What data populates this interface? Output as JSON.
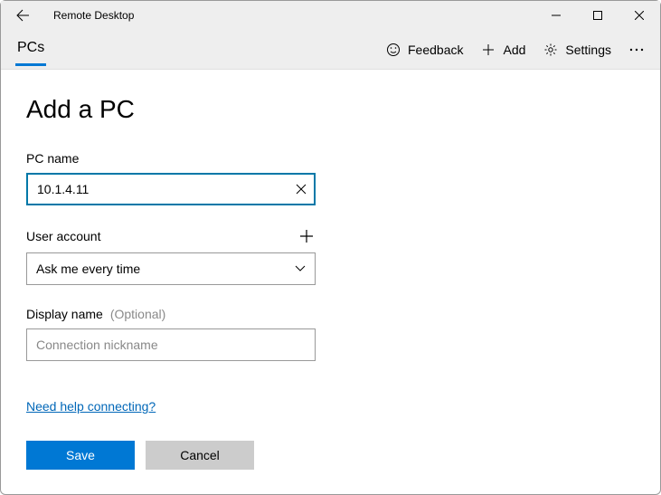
{
  "titlebar": {
    "app_name": "Remote Desktop"
  },
  "commandbar": {
    "tab_label": "PCs",
    "feedback_label": "Feedback",
    "add_label": "Add",
    "settings_label": "Settings"
  },
  "page": {
    "title": "Add a PC",
    "pc_name_label": "PC name",
    "pc_name_value": "10.1.4.11",
    "user_account_label": "User account",
    "user_account_value": "Ask me every time",
    "display_name_label": "Display name",
    "display_name_optional": "(Optional)",
    "display_name_placeholder": "Connection nickname",
    "help_link": "Need help connecting?",
    "save_label": "Save",
    "cancel_label": "Cancel"
  }
}
